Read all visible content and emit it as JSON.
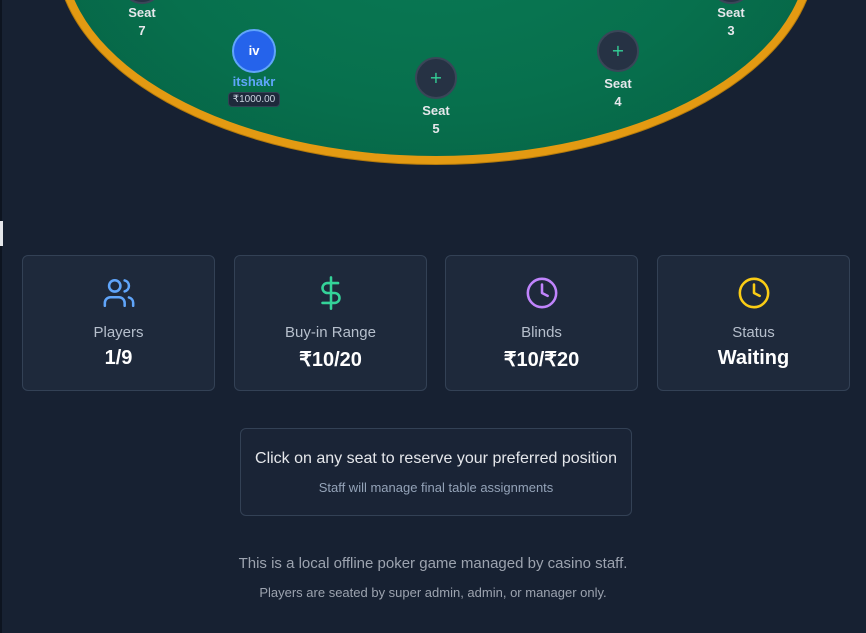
{
  "table": {
    "seats": [
      {
        "id": "7",
        "label": "Seat",
        "number": "7"
      },
      {
        "id": "3",
        "label": "Seat",
        "number": "3"
      },
      {
        "id": "5",
        "label": "Seat",
        "number": "5",
        "icon": "plus-icon"
      },
      {
        "id": "4",
        "label": "Seat",
        "number": "4",
        "icon": "plus-icon"
      }
    ],
    "player": {
      "initials": "iv",
      "name": "itshakr",
      "stack": "₹1000.00"
    },
    "colors": {
      "felt": "#07704d",
      "rim": "#e39a12",
      "player": "#2563eb"
    }
  },
  "stats": [
    {
      "label": "Players",
      "value": "1/9",
      "icon": "users-icon",
      "color": "#60a5fa"
    },
    {
      "label": "Buy-in Range",
      "value": "₹10/20",
      "icon": "dollar-icon",
      "color": "#34d399"
    },
    {
      "label": "Blinds",
      "value": "₹10/₹20",
      "icon": "clock-icon",
      "color": "#c084fc"
    },
    {
      "label": "Status",
      "value": "Waiting",
      "icon": "clock-icon",
      "color": "#facc15"
    }
  ],
  "info": {
    "main": "Click on any seat to reserve your preferred position",
    "sub": "Staff will manage final table assignments"
  },
  "footer": {
    "line1": "This is a local offline poker game managed by casino staff.",
    "line2": "Players are seated by super admin, admin, or manager only."
  }
}
